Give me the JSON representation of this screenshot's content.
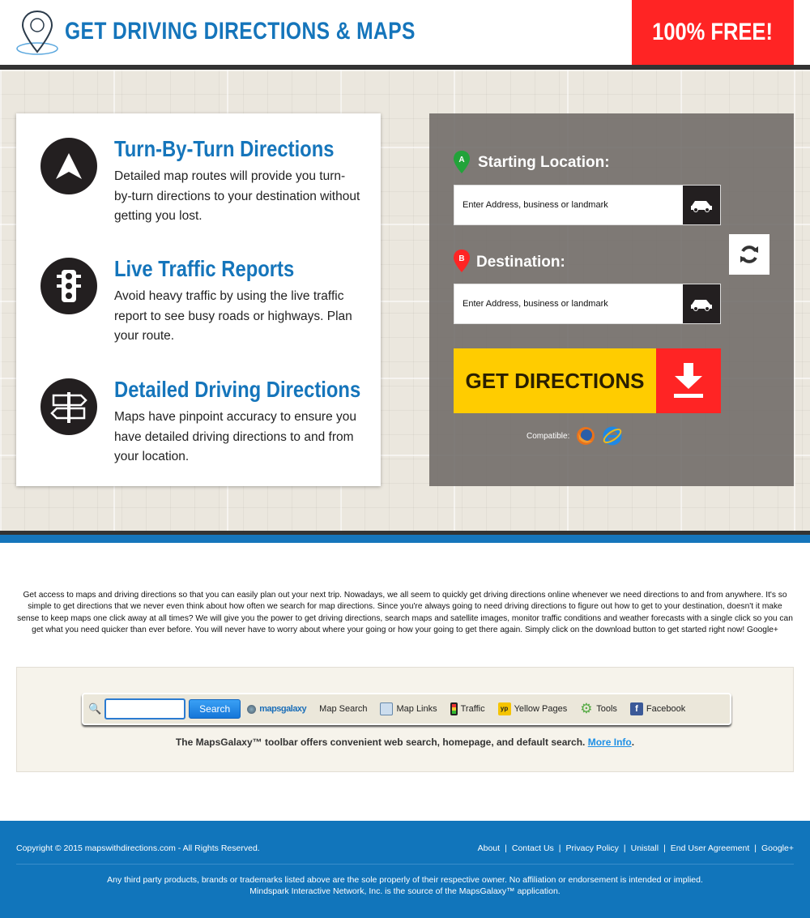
{
  "header": {
    "title": "GET DRIVING DIRECTIONS & MAPS",
    "badge": "100% FREE!",
    "logo_icon": "map-pin-icon"
  },
  "features": [
    {
      "title": "Turn-By-Turn Directions",
      "text": "Detailed map routes will provide you turn-by-turn directions to your destination without getting you lost.",
      "icon": "navigation-arrow-icon"
    },
    {
      "title": "Live Traffic Reports",
      "text": "Avoid heavy traffic by using the live traffic report to see busy roads or highways. Plan your route.",
      "icon": "traffic-light-icon"
    },
    {
      "title": "Detailed Driving Directions",
      "text": "Maps have pinpoint accuracy to ensure you have detailed driving directions to and from your location.",
      "icon": "signpost-icon"
    }
  ],
  "form": {
    "start_label": "Starting Location:",
    "start_pin": "A",
    "start_placeholder": "Enter Address, business or landmark",
    "dest_label": "Destination:",
    "dest_pin": "B",
    "dest_placeholder": "Enter Address, business or landmark",
    "button": "GET DIRECTIONS",
    "compatible": "Compatible:"
  },
  "about": "Get access to maps and driving directions so that you can easily plan out your next trip. Nowadays, we all seem to quickly get driving directions online whenever we need directions to and from anywhere. It's so simple to get directions that we never even think about how often we search for map directions. Since you're always going to need driving directions to figure out how to get to your destination, doesn't it make sense to keep maps one click away at all times? We will give you the power to get driving directions, search maps and satellite images, monitor traffic conditions and weather forecasts with a single click so you can get what you need quicker than ever before. You will never have to worry about where your going or how your going to get there again. Simply click on the download button to get started right now! Google+",
  "toolbar": {
    "search_button": "Search",
    "brand": "mapsgalaxy",
    "items": [
      "Map Search",
      "Map Links",
      "Traffic",
      "Yellow Pages",
      "Tools",
      "Facebook"
    ],
    "note": "The MapsGalaxy™ toolbar offers convenient web search, homepage, and default search.",
    "more_info": "More Info"
  },
  "footer": {
    "copyright": "Copyright © 2015 mapswithdirections.com - All Rights Reserved.",
    "links": [
      "About",
      "Contact Us",
      "Privacy Policy",
      "Unistall",
      "End User Agreement",
      "Google+"
    ],
    "disclaimer1": "Any third party products, brands or trademarks listed above are the sole properly of their respective owner. No affiliation or endorsement is intended or implied.",
    "disclaimer2": "Mindspark Interactive Network, Inc. is the source of the MapsGalaxy™ application."
  },
  "colors": {
    "brand_blue": "#1575bb",
    "red": "#ff2424",
    "yellow": "#ffcc00"
  }
}
